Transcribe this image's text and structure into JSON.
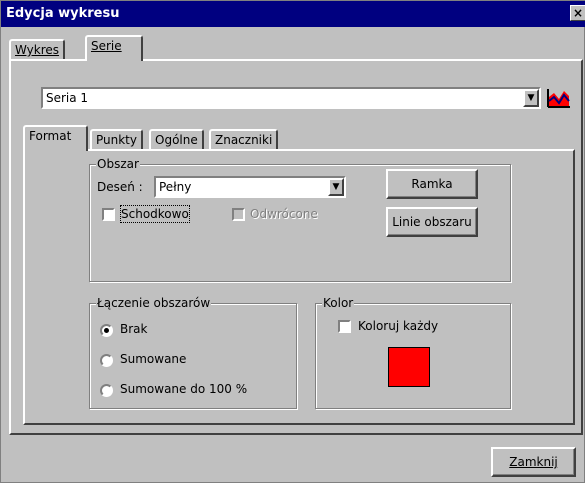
{
  "window": {
    "title": "Edycja wykresu",
    "close_glyph": "×"
  },
  "top_tabs": [
    {
      "label": "Wykres",
      "active": false
    },
    {
      "label": "Serie",
      "active": true
    }
  ],
  "series_select": {
    "value": "Seria 1",
    "icon": "area-chart-icon"
  },
  "inner_tabs": [
    {
      "label": "Format",
      "active": true
    },
    {
      "label": "Punkty",
      "active": false
    },
    {
      "label": "Ogólne",
      "active": false
    },
    {
      "label": "Znaczniki",
      "active": false
    }
  ],
  "obszar": {
    "legend": "Obszar",
    "pattern_label": "Deseń :",
    "pattern_value": "Pełny",
    "stepped_label": "Schodkowo",
    "stepped_checked": false,
    "inverted_label": "Odwrócone",
    "inverted_checked": false,
    "frame_button": "Ramka",
    "area_lines_button": "Linie obszaru"
  },
  "stacking": {
    "legend": "Łączenie obszarów",
    "options": [
      {
        "label": "Brak",
        "selected": true
      },
      {
        "label": "Sumowane",
        "selected": false
      },
      {
        "label": "Sumowane do 100 %",
        "selected": false
      }
    ]
  },
  "color": {
    "legend": "Kolor",
    "color_each_label": "Koloruj każdy",
    "color_each_checked": false,
    "swatch_color": "#ff0000"
  },
  "footer": {
    "close_button": "Zamknij"
  }
}
